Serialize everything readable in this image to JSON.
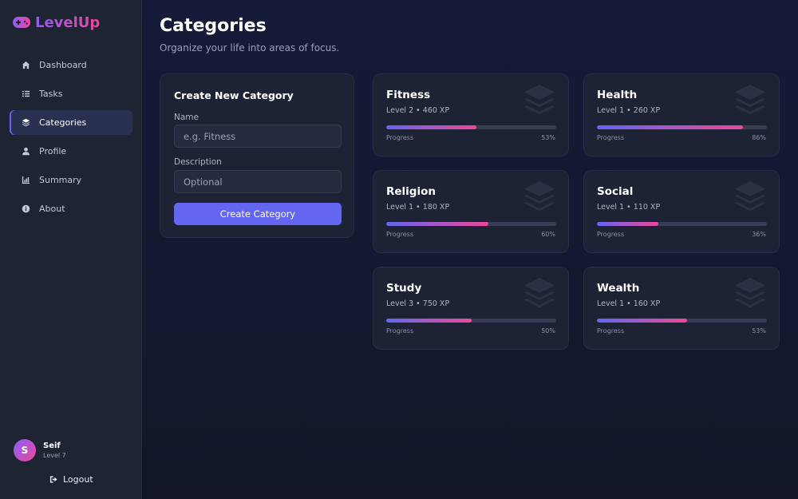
{
  "app": {
    "brand": "LevelUp",
    "brand_icon": "gamepad-icon"
  },
  "sidebar": {
    "items": [
      {
        "label": "Dashboard",
        "icon": "home-icon",
        "active": false
      },
      {
        "label": "Tasks",
        "icon": "list-icon",
        "active": false
      },
      {
        "label": "Categories",
        "icon": "layers-icon",
        "active": true
      },
      {
        "label": "Profile",
        "icon": "user-icon",
        "active": false
      },
      {
        "label": "Summary",
        "icon": "chart-icon",
        "active": false
      },
      {
        "label": "About",
        "icon": "info-icon",
        "active": false
      }
    ],
    "user": {
      "initial": "S",
      "name": "Seif",
      "level": "Level 7"
    },
    "logout_label": "Logout"
  },
  "main": {
    "title": "Categories",
    "subtitle": "Organize your life into areas of focus.",
    "create": {
      "title": "Create New Category",
      "name_label": "Name",
      "name_placeholder": "e.g. Fitness",
      "name_value": "",
      "description_label": "Description",
      "description_placeholder": "Optional",
      "description_value": "",
      "button_label": "Create Category"
    },
    "progress_label": "Progress",
    "categories": [
      {
        "name": "Fitness",
        "meta": "Level 2 • 460 XP",
        "progress": 53,
        "progress_text": "53%"
      },
      {
        "name": "Health",
        "meta": "Level 1 • 260 XP",
        "progress": 86,
        "progress_text": "86%"
      },
      {
        "name": "Religion",
        "meta": "Level 1 • 180 XP",
        "progress": 60,
        "progress_text": "60%"
      },
      {
        "name": "Social",
        "meta": "Level 1 • 110 XP",
        "progress": 36,
        "progress_text": "36%"
      },
      {
        "name": "Study",
        "meta": "Level 3 • 750 XP",
        "progress": 50,
        "progress_text": "50%"
      },
      {
        "name": "Wealth",
        "meta": "Level 1 • 160 XP",
        "progress": 53,
        "progress_text": "53%"
      }
    ]
  },
  "colors": {
    "accent": "#6366f1",
    "gradient_end": "#ec4899",
    "sidebar_bg": "#1f2433",
    "card_bg": "#1d2234"
  }
}
